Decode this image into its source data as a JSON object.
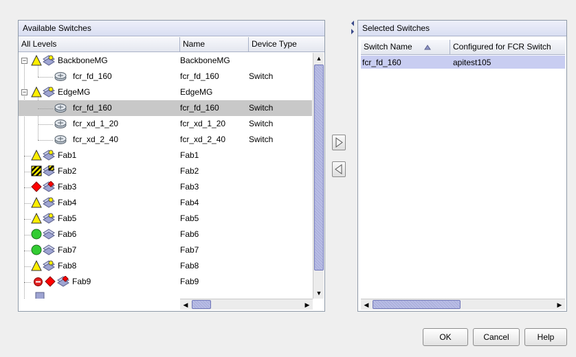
{
  "available": {
    "title": "Available Switches",
    "columns": [
      "All Levels",
      "Name",
      "Device Type"
    ],
    "rows": [
      {
        "label": "BackboneMG",
        "name": "BackboneMG",
        "type": ""
      },
      {
        "label": "fcr_fd_160",
        "name": "fcr_fd_160",
        "type": "Switch"
      },
      {
        "label": "EdgeMG",
        "name": "EdgeMG",
        "type": ""
      },
      {
        "label": "fcr_fd_160",
        "name": "fcr_fd_160",
        "type": "Switch"
      },
      {
        "label": "fcr_xd_1_20",
        "name": "fcr_xd_1_20",
        "type": "Switch"
      },
      {
        "label": "fcr_xd_2_40",
        "name": "fcr_xd_2_40",
        "type": "Switch"
      },
      {
        "label": "Fab1",
        "name": "Fab1",
        "type": ""
      },
      {
        "label": "Fab2",
        "name": "Fab2",
        "type": ""
      },
      {
        "label": "Fab3",
        "name": "Fab3",
        "type": ""
      },
      {
        "label": "Fab4",
        "name": "Fab4",
        "type": ""
      },
      {
        "label": "Fab5",
        "name": "Fab5",
        "type": ""
      },
      {
        "label": "Fab6",
        "name": "Fab6",
        "type": ""
      },
      {
        "label": "Fab7",
        "name": "Fab7",
        "type": ""
      },
      {
        "label": "Fab8",
        "name": "Fab8",
        "type": ""
      },
      {
        "label": "Fab9",
        "name": "Fab9",
        "type": ""
      }
    ]
  },
  "selected": {
    "title": "Selected Switches",
    "columns": [
      "Switch Name",
      "Configured for FCR Switch"
    ],
    "rows": [
      {
        "switch_name": "fcr_fd_160",
        "configured": "apitest105"
      }
    ]
  },
  "buttons": {
    "ok": "OK",
    "cancel": "Cancel",
    "help": "Help"
  },
  "icons": {
    "sort_ascending": "sort-ascending-icon",
    "add": "move-right-icon",
    "remove": "move-left-icon"
  },
  "colors": {
    "selection_gray": "#c8c8c8",
    "selection_blue": "#c8cdf1",
    "warning_yellow": "#ffee00",
    "error_red": "#ff0000",
    "healthy_green": "#33cc33"
  }
}
